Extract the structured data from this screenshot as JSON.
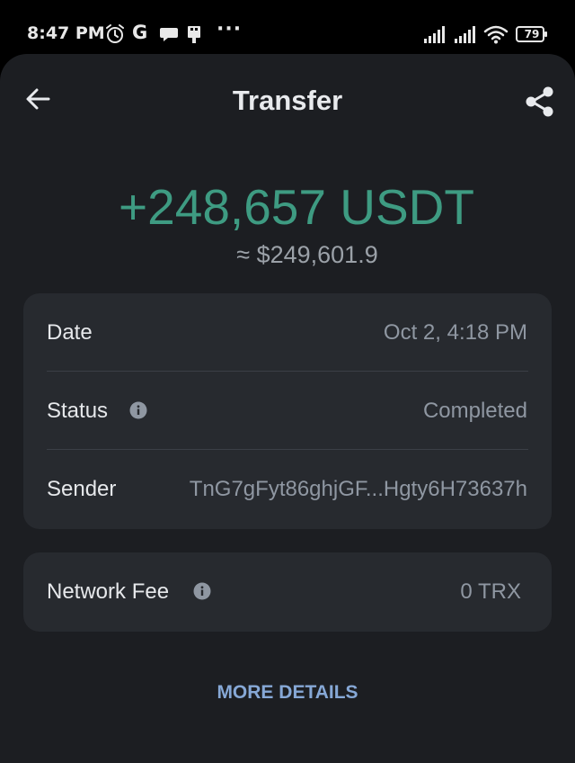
{
  "status_bar": {
    "time": "8:47 PM",
    "google_letter": "G",
    "overflow": "···",
    "battery": "79",
    "icons": [
      "alarm-icon",
      "google-icon",
      "chat-bubble-icon",
      "usb-icon",
      "more-dots-icon",
      "signal-icon",
      "signal-icon",
      "wifi-icon",
      "battery-icon"
    ]
  },
  "header": {
    "title": "Transfer",
    "back_icon": "arrow-left-icon",
    "share_icon": "share-icon"
  },
  "transaction": {
    "amount": "+248,657 USDT",
    "fiat_value": "≈ $249,601.9",
    "amount_color": "#3e9b82"
  },
  "details": {
    "rows": [
      {
        "label": "Date",
        "value": "Oct 2, 4:18 PM",
        "info_icon": false
      },
      {
        "label": "Status",
        "value": "Completed",
        "info_icon": true
      },
      {
        "label": "Sender",
        "value": "TnG7gFyt86ghjGF...Hgty6H73637h",
        "info_icon": false
      }
    ]
  },
  "fee": {
    "label": "Network Fee",
    "value": "0 TRX",
    "info_icon": true
  },
  "actions": {
    "more_details": "MORE DETAILS",
    "link_color": "#86a8d6"
  }
}
